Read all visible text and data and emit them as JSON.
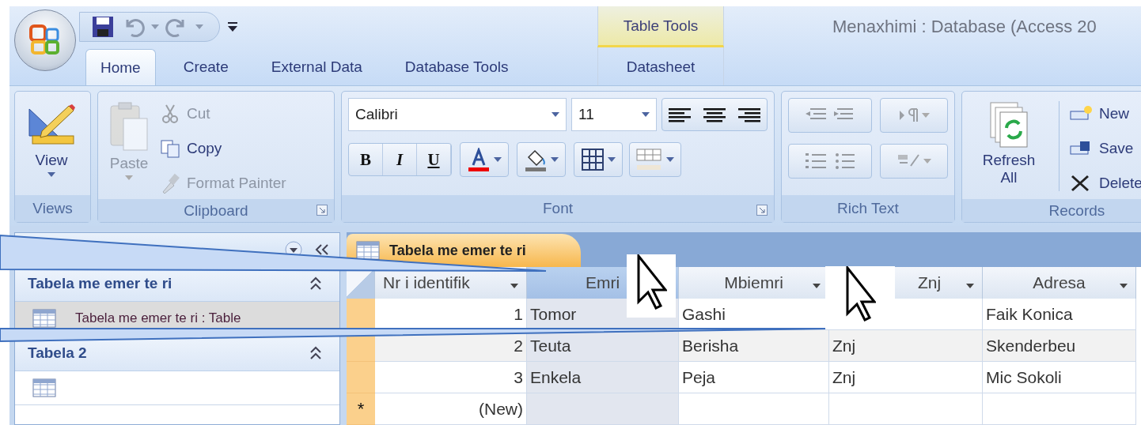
{
  "app": {
    "title": "Menaxhimi : Database (Access 20"
  },
  "contextual": {
    "label": "Table Tools",
    "tabs": [
      {
        "label": "Datasheet",
        "selected": false
      }
    ]
  },
  "tabs": [
    {
      "label": "Home",
      "selected": true
    },
    {
      "label": "Create",
      "selected": false
    },
    {
      "label": "External Data",
      "selected": false
    },
    {
      "label": "Database Tools",
      "selected": false
    }
  ],
  "ribbon": [
    {
      "kind": "views",
      "title": "Views",
      "buttons": [
        {
          "label": "View",
          "disabled": false
        }
      ]
    },
    {
      "kind": "clipboard",
      "title": "Clipboard",
      "buttons": [
        {
          "label": "Paste",
          "disabled": true
        },
        {
          "label": "Cut",
          "disabled": true
        },
        {
          "label": "Copy",
          "disabled": false
        },
        {
          "label": "Format Painter",
          "disabled": true
        }
      ]
    },
    {
      "kind": "font",
      "title": "Font",
      "font_name": "Calibri",
      "font_size": "11",
      "buttons": [
        {
          "label": "B"
        },
        {
          "label": "I"
        },
        {
          "label": "U"
        }
      ]
    },
    {
      "kind": "rich_text",
      "title": "Rich Text"
    },
    {
      "kind": "records",
      "title": "Records",
      "buttons": [
        {
          "label": "Refresh All"
        },
        {
          "label": "New"
        },
        {
          "label": "Save"
        },
        {
          "label": "Delete"
        }
      ]
    }
  ],
  "nav": {
    "groups": [
      {
        "title": "Tabela me emer te ri",
        "expanded": true,
        "items": [
          {
            "label": "Tabela me emer te ri : Table",
            "selected": true
          }
        ]
      },
      {
        "title": "Tabela 2",
        "expanded": true,
        "items": [
          {
            "selected": false
          }
        ]
      }
    ]
  },
  "document": {
    "tab": "Tabela me emer te ri",
    "columns": [
      {
        "label": "Nr i identifik",
        "selected": false
      },
      {
        "label": "Emri",
        "selected": true
      },
      {
        "label": "Mbiemri",
        "selected": false
      },
      {
        "label": "Znj",
        "selected": false
      },
      {
        "label": "Adresa",
        "selected": false
      }
    ],
    "rows": [
      {
        "cells": [
          "1",
          "Tomor",
          "Gashi",
          null,
          "Faik Konica"
        ]
      },
      {
        "cells": [
          "2",
          "Teuta",
          "Berisha",
          "Znj",
          "Skenderbeu"
        ]
      },
      {
        "cells": [
          "3",
          "Enkela",
          "Peja",
          "Znj",
          "Mic Sokoli"
        ]
      }
    ],
    "new_row": {
      "marker": "*",
      "label": "(New)"
    }
  }
}
